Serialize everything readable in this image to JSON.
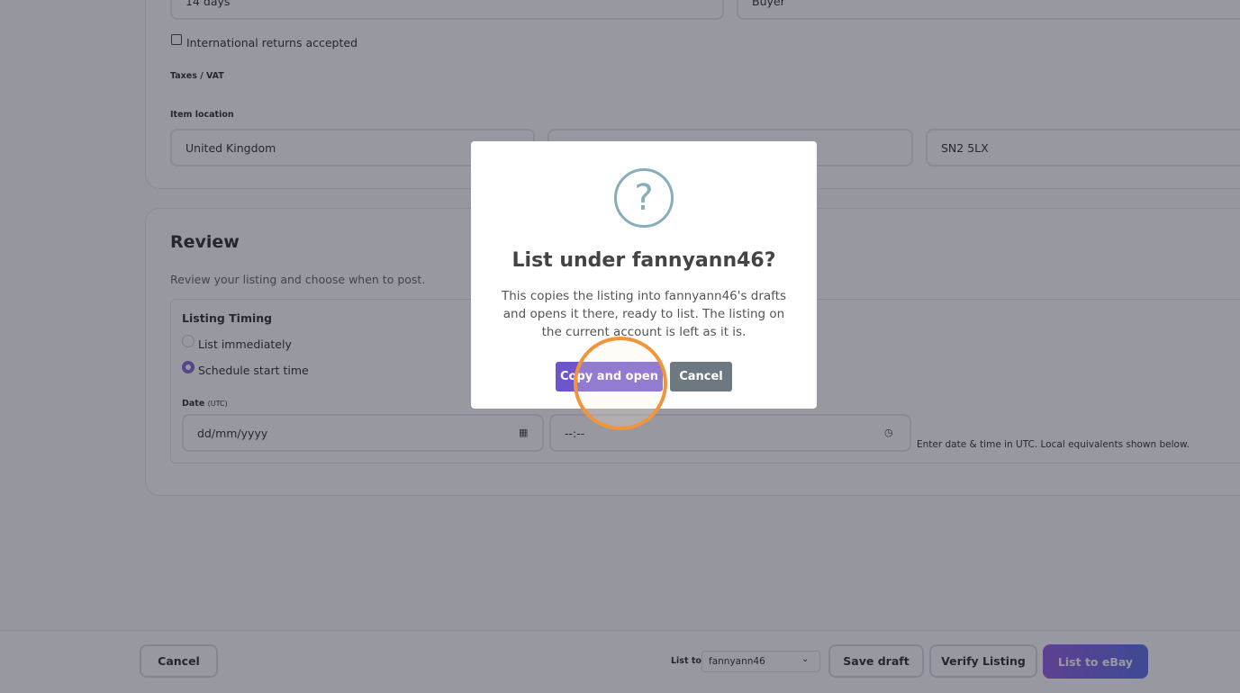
{
  "returns": {
    "period_value": "14 days",
    "paid_by_value": "Buyer",
    "international_label": "International returns accepted"
  },
  "taxes_label": "Taxes / VAT",
  "location": {
    "label": "Item location",
    "country": "United Kingdom",
    "city": "",
    "postcode": "SN2 5LX"
  },
  "review": {
    "title": "Review",
    "subtitle": "Review your listing and choose when to post.",
    "timing_title": "Listing Timing",
    "option_immediate": "List immediately",
    "option_schedule": "Schedule start time",
    "selected_option": "Schedule start time",
    "date_label": "Date",
    "date_unit": "(UTC)",
    "date_placeholder": "dd/mm/yyyy",
    "time_placeholder": "--:--",
    "hint": "Enter date & time in UTC. Local equivalents shown below."
  },
  "footer": {
    "cancel_label": "Cancel",
    "list_to_label": "List to",
    "account_value": "fannyann46",
    "save_draft_label": "Save draft",
    "verify_label": "Verify Listing",
    "list_ebay_label": "List to eBay"
  },
  "modal": {
    "icon_glyph": "?",
    "title": "List under fannyann46?",
    "body": "This copies the listing into fannyann46's drafts and opens it there, ready to list. The listing on the current account is left as it is.",
    "confirm_label": "Copy and open",
    "cancel_label": "Cancel"
  },
  "colors": {
    "accent": "#6f55cc",
    "primary_gradient_start": "#8a4fe0",
    "primary_gradient_end": "#4a62e6",
    "modal_icon": "#87aeb8",
    "click_ring": "#f0953c"
  }
}
